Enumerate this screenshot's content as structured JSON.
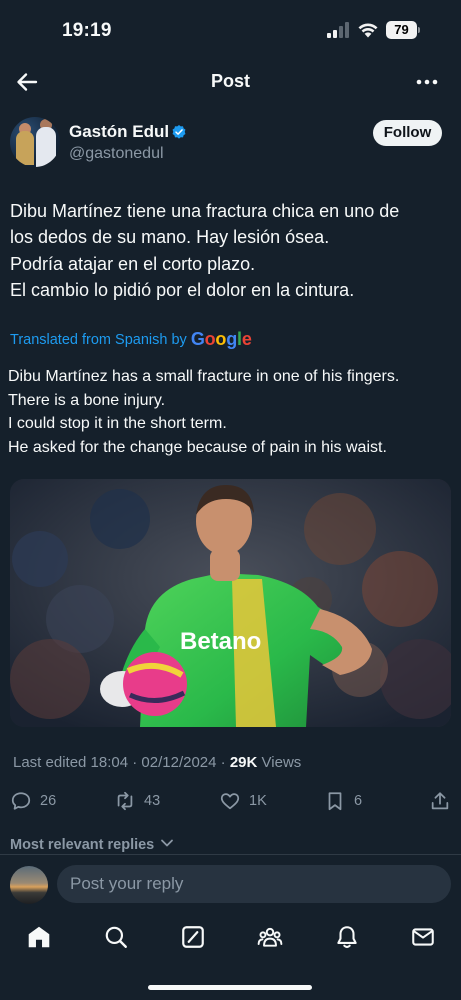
{
  "status_bar": {
    "time": "19:19",
    "battery": "79"
  },
  "header": {
    "title": "Post"
  },
  "author": {
    "name": "Gastón Edul",
    "handle": "@gastonedul"
  },
  "follow_label": "Follow",
  "post": {
    "lines": [
      "Dibu Martínez tiene una fractura chica en uno de",
      "los dedos de su mano. Hay lesión ósea.",
      "Podría atajar en el corto plazo.",
      "El cambio lo pidió por el dolor en la cintura."
    ],
    "translated_label": "Translated from Spanish by",
    "translation_lines": [
      "Dibu Martínez has a small fracture in one of his fingers.",
      "There is a bone injury.",
      "I could stop it in the short term.",
      "He asked for the change because of pain in his waist."
    ],
    "media": {
      "shirt_text": "Betano"
    }
  },
  "meta": {
    "edited": "Last edited 18:04 · 02/12/2024 ·",
    "views_count": "29K",
    "views_label": "Views"
  },
  "actions": {
    "replies": "26",
    "reposts": "43",
    "likes": "1K",
    "bookmarks": "6"
  },
  "replies_sort": "Most relevant replies",
  "reply_placeholder": "Post your reply",
  "colors": {
    "background": "#15202b",
    "accent": "#1d9bf0",
    "muted": "#8b98a5"
  },
  "icons": [
    "back-arrow-icon",
    "more-icon",
    "verified-badge-icon",
    "reply-icon",
    "repost-icon",
    "like-icon",
    "bookmark-icon",
    "share-icon",
    "home-icon",
    "search-icon",
    "grok-icon",
    "communities-icon",
    "notifications-icon",
    "messages-icon"
  ]
}
